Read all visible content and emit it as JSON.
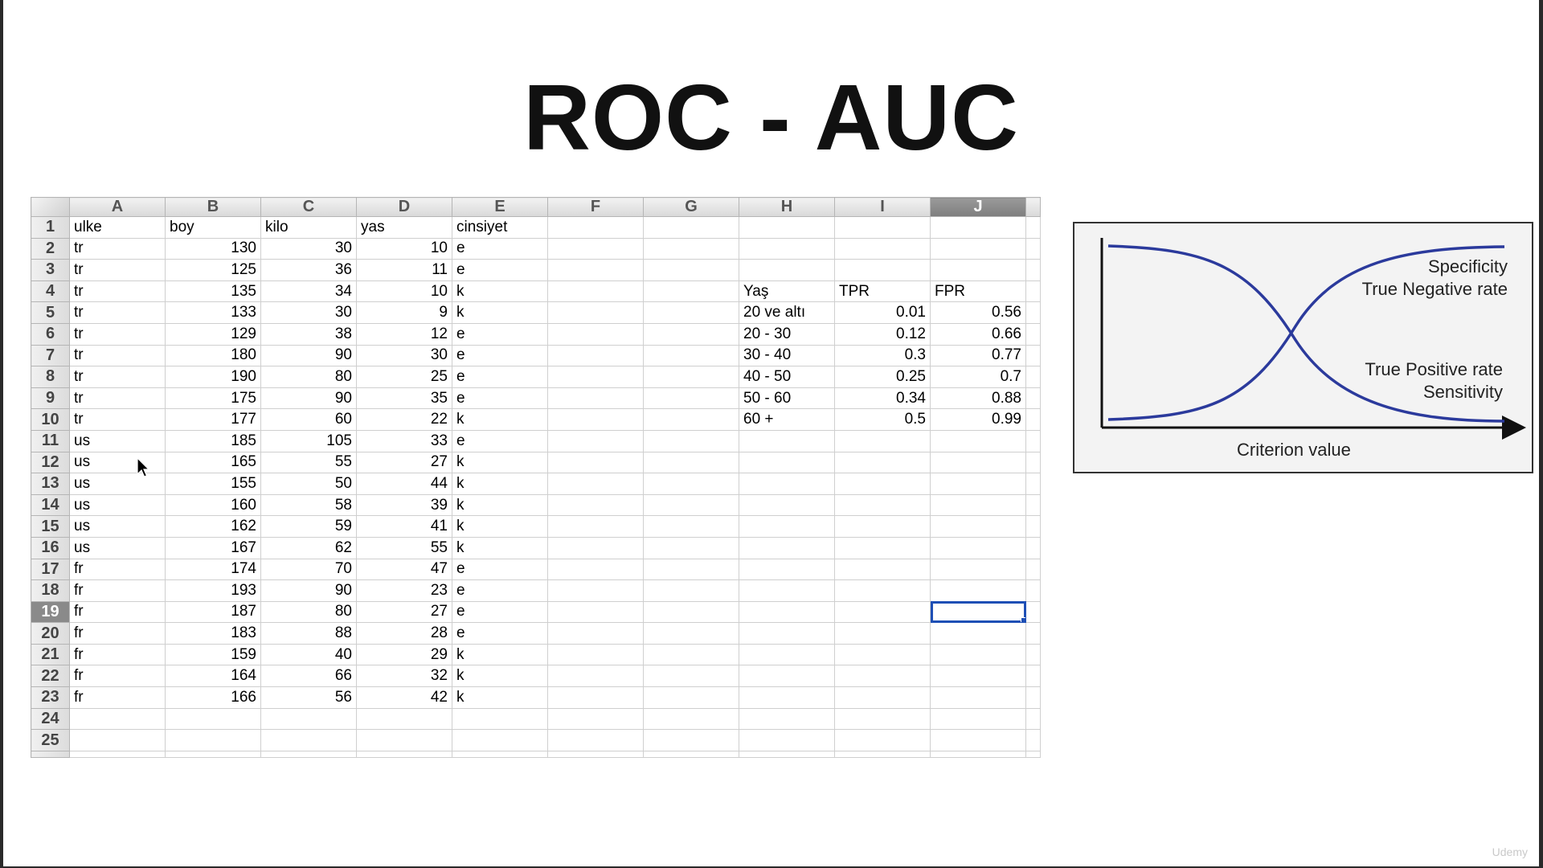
{
  "slide": {
    "title": "ROC - AUC",
    "watermark": "Udemy"
  },
  "sheet": {
    "columns": [
      "A",
      "B",
      "C",
      "D",
      "E",
      "F",
      "G",
      "H",
      "I",
      "J"
    ],
    "selected_column": "J",
    "selected_row": 19,
    "active_cell": "J19",
    "rows": [
      [
        "ulke",
        "boy",
        "kilo",
        "yas",
        "cinsiyet",
        "",
        "",
        "",
        "",
        ""
      ],
      [
        "tr",
        "130",
        "30",
        "10",
        "e",
        "",
        "",
        "",
        "",
        ""
      ],
      [
        "tr",
        "125",
        "36",
        "11",
        "e",
        "",
        "",
        "",
        "",
        ""
      ],
      [
        "tr",
        "135",
        "34",
        "10",
        "k",
        "",
        "",
        "Yaş",
        "TPR",
        "FPR"
      ],
      [
        "tr",
        "133",
        "30",
        "9",
        "k",
        "",
        "",
        "20 ve altı",
        "0.01",
        "0.56"
      ],
      [
        "tr",
        "129",
        "38",
        "12",
        "e",
        "",
        "",
        "20 - 30",
        "0.12",
        "0.66"
      ],
      [
        "tr",
        "180",
        "90",
        "30",
        "e",
        "",
        "",
        "30 - 40",
        "0.3",
        "0.77"
      ],
      [
        "tr",
        "190",
        "80",
        "25",
        "e",
        "",
        "",
        "40 - 50",
        "0.25",
        "0.7"
      ],
      [
        "tr",
        "175",
        "90",
        "35",
        "e",
        "",
        "",
        "50 - 60",
        "0.34",
        "0.88"
      ],
      [
        "tr",
        "177",
        "60",
        "22",
        "k",
        "",
        "",
        "60 +",
        "0.5",
        "0.99"
      ],
      [
        "us",
        "185",
        "105",
        "33",
        "e",
        "",
        "",
        "",
        "",
        ""
      ],
      [
        "us",
        "165",
        "55",
        "27",
        "k",
        "",
        "",
        "",
        "",
        ""
      ],
      [
        "us",
        "155",
        "50",
        "44",
        "k",
        "",
        "",
        "",
        "",
        ""
      ],
      [
        "us",
        "160",
        "58",
        "39",
        "k",
        "",
        "",
        "",
        "",
        ""
      ],
      [
        "us",
        "162",
        "59",
        "41",
        "k",
        "",
        "",
        "",
        "",
        ""
      ],
      [
        "us",
        "167",
        "62",
        "55",
        "k",
        "",
        "",
        "",
        "",
        ""
      ],
      [
        "fr",
        "174",
        "70",
        "47",
        "e",
        "",
        "",
        "",
        "",
        ""
      ],
      [
        "fr",
        "193",
        "90",
        "23",
        "e",
        "",
        "",
        "",
        "",
        ""
      ],
      [
        "fr",
        "187",
        "80",
        "27",
        "e",
        "",
        "",
        "",
        "",
        ""
      ],
      [
        "fr",
        "183",
        "88",
        "28",
        "e",
        "",
        "",
        "",
        "",
        ""
      ],
      [
        "fr",
        "159",
        "40",
        "29",
        "k",
        "",
        "",
        "",
        "",
        ""
      ],
      [
        "fr",
        "164",
        "66",
        "32",
        "k",
        "",
        "",
        "",
        "",
        ""
      ],
      [
        "fr",
        "166",
        "56",
        "42",
        "k",
        "",
        "",
        "",
        "",
        ""
      ],
      [
        "",
        "",
        "",
        "",
        "",
        "",
        "",
        "",
        "",
        ""
      ],
      [
        "",
        "",
        "",
        "",
        "",
        "",
        "",
        "",
        "",
        ""
      ]
    ]
  },
  "figure": {
    "specificity_line1": "Specificity",
    "specificity_line2": "True Negative rate",
    "tpr_line1": "True Positive rate",
    "tpr_line2": "Sensitivity",
    "xlabel": "Criterion value",
    "curve_color": "#2b3a9c"
  }
}
